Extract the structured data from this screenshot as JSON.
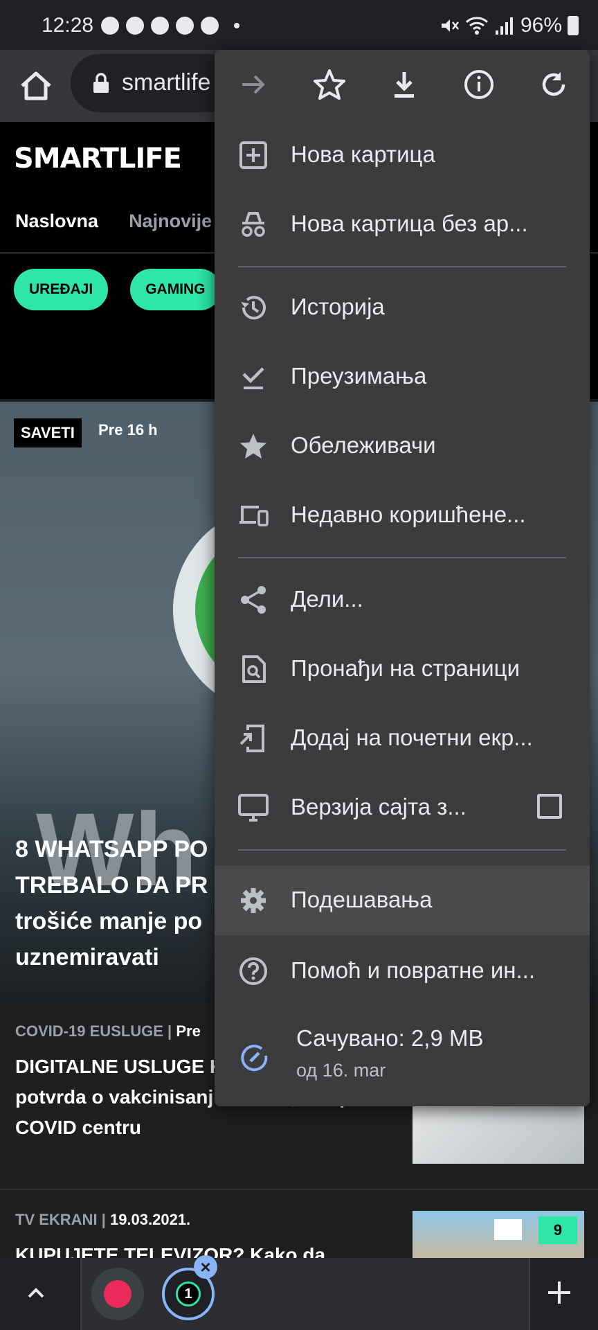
{
  "status_bar": {
    "time": "12:28",
    "battery": "96%",
    "notification_icons": [
      "messenger-icon",
      "chrome-icon",
      "chrome-icon",
      "chrome-icon",
      "chrome-icon"
    ]
  },
  "toolbar": {
    "url": "smartlife"
  },
  "site": {
    "logo": "SMARTLIFE",
    "nav": [
      "Naslovna",
      "Najnovije"
    ],
    "pills": [
      "UREĐAJI",
      "GAMING"
    ],
    "hero": {
      "badge": "SAVETI",
      "time": "Pre 16 h",
      "watermark": "Wh",
      "title_line1": "8 WHATSAPP PO",
      "title_line2": "TREBALO DA PR",
      "title_line3": "trošiće manje po",
      "title_line4": "uznemiravati"
    },
    "articles": [
      {
        "category": "COVID-19 EUSLUGE",
        "date": "Pre",
        "title": "DIGITALNE USLUGE KORONE: Novi term potvrda o vakcinisanju na klik, bez posete COVID centru"
      },
      {
        "category": "TV EKRANI",
        "date": "19.03.2021.",
        "title": "KUPUJETE TELEVIZOR? Kako da",
        "thumb_count": "9"
      }
    ]
  },
  "menu": {
    "top_icons": [
      "forward-icon",
      "star-icon",
      "download-icon",
      "info-icon",
      "refresh-icon"
    ],
    "items": [
      {
        "label": "Нова картица",
        "icon": "new-tab-icon"
      },
      {
        "label": "Нова картица без ар...",
        "icon": "incognito-icon"
      },
      {
        "label": "Историја",
        "icon": "history-icon"
      },
      {
        "label": "Преузимања",
        "icon": "downloads-icon"
      },
      {
        "label": "Обележивачи",
        "icon": "bookmark-star-icon"
      },
      {
        "label": "Недавно коришћене...",
        "icon": "devices-icon"
      },
      {
        "label": "Дели...",
        "icon": "share-icon"
      },
      {
        "label": "Пронађи на страници",
        "icon": "find-in-page-icon"
      },
      {
        "label": "Додај на почетни екр...",
        "icon": "add-to-home-icon"
      },
      {
        "label": "Верзија сајта з...",
        "icon": "desktop-icon",
        "checked": false
      },
      {
        "label": "Подешавања",
        "icon": "gear-icon"
      },
      {
        "label": "Помоћ и повратне ин...",
        "icon": "help-icon"
      }
    ],
    "saved": {
      "line1": "Сачувано: 2,9 MB",
      "line2": "од 16. mar"
    }
  },
  "colors": {
    "accent": "#2ee6a6",
    "menu_bg": "#3c3c3f",
    "highlight": "#4a4a4d",
    "tab_ring": "#8ab4f8"
  }
}
